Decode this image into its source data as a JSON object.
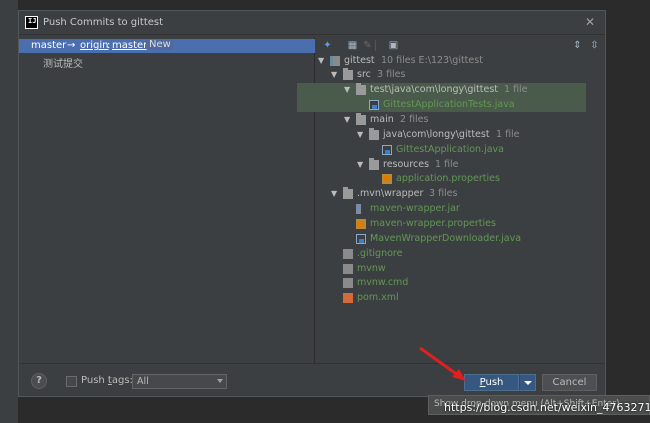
{
  "dialog": {
    "title": "Push Commits to gittest"
  },
  "commits": {
    "branch_local": "master",
    "arrow": "→",
    "remote": "origin",
    "colon": ":",
    "branch_remote": "master",
    "badge": "New",
    "message": "测试提交"
  },
  "tree": [
    {
      "label": "gittest",
      "count": "10 files  E:\\123\\gittest",
      "kind": "module",
      "expanded": true
    },
    {
      "label": "src",
      "count": "3 files",
      "kind": "folder",
      "expanded": true
    },
    {
      "label": "test\\java\\com\\longy\\gittest",
      "count": "1 file",
      "kind": "folder",
      "expanded": true
    },
    {
      "label": "GittestApplicationTests.java",
      "count": "",
      "kind": "java"
    },
    {
      "label": "main",
      "count": "2 files",
      "kind": "folder",
      "expanded": true
    },
    {
      "label": "java\\com\\longy\\gittest",
      "count": "1 file",
      "kind": "folder",
      "expanded": true
    },
    {
      "label": "GittestApplication.java",
      "count": "",
      "kind": "java"
    },
    {
      "label": "resources",
      "count": "1 file",
      "kind": "folder",
      "expanded": true
    },
    {
      "label": "application.properties",
      "count": "",
      "kind": "props"
    },
    {
      "label": ".mvn\\wrapper",
      "count": "3 files",
      "kind": "folder",
      "expanded": true
    },
    {
      "label": "maven-wrapper.jar",
      "count": "",
      "kind": "jar"
    },
    {
      "label": "maven-wrapper.properties",
      "count": "",
      "kind": "props"
    },
    {
      "label": "MavenWrapperDownloader.java",
      "count": "",
      "kind": "java"
    },
    {
      "label": ".gitignore",
      "count": "",
      "kind": "file"
    },
    {
      "label": "mvnw",
      "count": "",
      "kind": "file"
    },
    {
      "label": "mvnw.cmd",
      "count": "",
      "kind": "file"
    },
    {
      "label": "pom.xml",
      "count": "",
      "kind": "xml"
    }
  ],
  "footer": {
    "help": "?",
    "push_tags_label_pre": "Push ",
    "push_tags_label_u": "t",
    "push_tags_label_post": "ags:",
    "tags_value": "All",
    "push_label_u": "P",
    "push_label_rest": "ush",
    "cancel_label": "Cancel"
  },
  "tooltip": {
    "text": "Show drop-down menu (Alt+Shift+Enter)"
  },
  "watermark": "https://blog.csdn.net/weixin_47632717",
  "colors": {
    "selection": "#4b6eaf",
    "push_button": "#365880",
    "added_file": "#629755",
    "highlight_row": "#4b5b4b"
  }
}
